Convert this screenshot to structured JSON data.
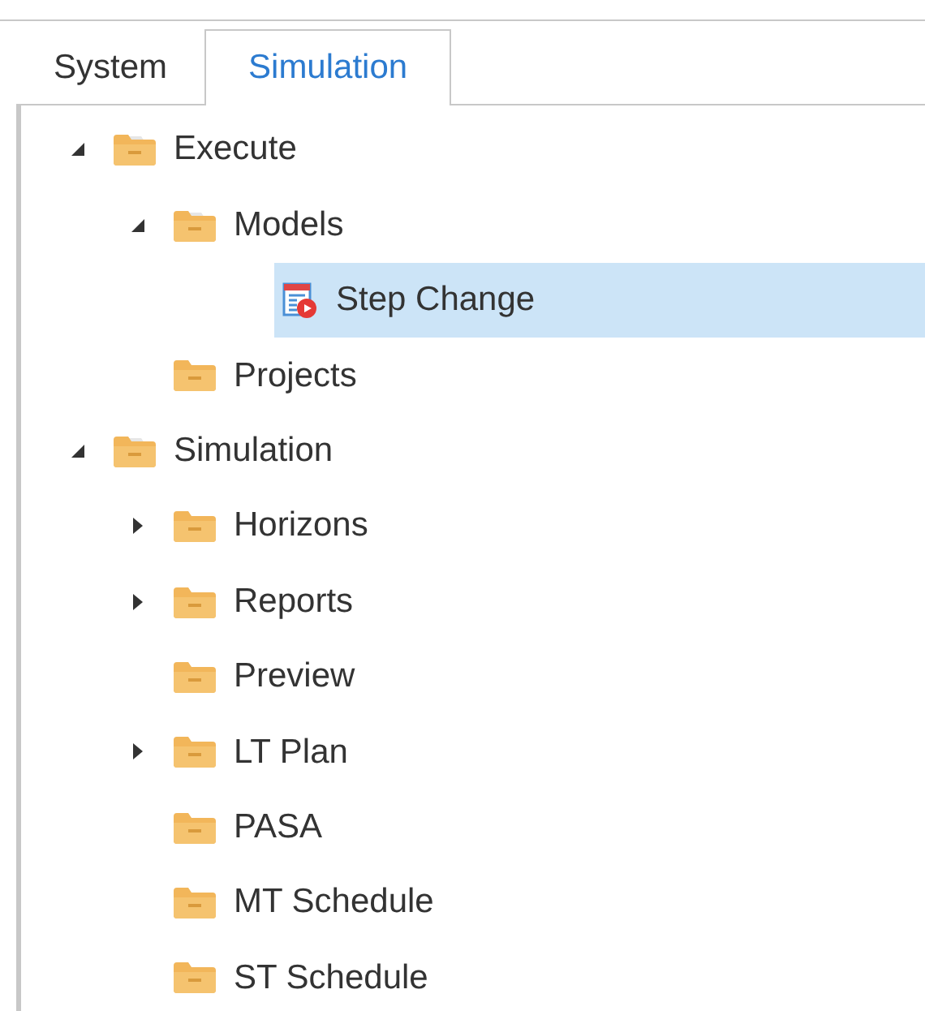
{
  "tabs": [
    {
      "label": "System",
      "selected": false
    },
    {
      "label": "Simulation",
      "selected": true
    }
  ],
  "tree": [
    {
      "label": "Execute",
      "kind": "folder",
      "expanded": true,
      "selected": false,
      "children": [
        {
          "label": "Models",
          "kind": "folder",
          "expanded": true,
          "selected": false,
          "children": [
            {
              "label": "Step Change",
              "kind": "model",
              "selected": true
            }
          ]
        },
        {
          "label": "Projects",
          "kind": "folder",
          "selected": false
        }
      ]
    },
    {
      "label": "Simulation",
      "kind": "folder",
      "expanded": true,
      "selected": false,
      "children": [
        {
          "label": "Horizons",
          "kind": "folder",
          "expanded": false,
          "selected": false
        },
        {
          "label": "Reports",
          "kind": "folder",
          "expanded": false,
          "selected": false
        },
        {
          "label": "Preview",
          "kind": "folder",
          "selected": false
        },
        {
          "label": "LT Plan",
          "kind": "folder",
          "expanded": false,
          "selected": false
        },
        {
          "label": "PASA",
          "kind": "folder",
          "selected": false
        },
        {
          "label": "MT Schedule",
          "kind": "folder",
          "selected": false
        },
        {
          "label": "ST Schedule",
          "kind": "folder",
          "selected": false
        }
      ]
    }
  ]
}
